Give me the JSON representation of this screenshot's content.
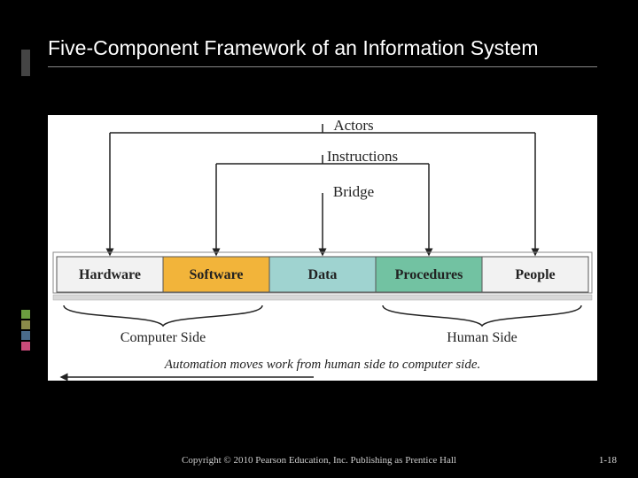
{
  "title": "Five-Component Framework of an Information System",
  "labels": {
    "actors": "Actors",
    "instructions": "Instructions",
    "bridge": "Bridge"
  },
  "components": [
    {
      "name": "Hardware",
      "color": "#f2f2f2"
    },
    {
      "name": "Software",
      "color": "#f2b43a"
    },
    {
      "name": "Data",
      "color": "#9fd3d0"
    },
    {
      "name": "Procedures",
      "color": "#72c2a2"
    },
    {
      "name": "People",
      "color": "#f2f2f2"
    }
  ],
  "sides": {
    "computer": "Computer Side",
    "human": "Human Side"
  },
  "caption": "Automation moves work from human side to computer side.",
  "copyright": "Copyright © 2010 Pearson Education, Inc. Publishing as Prentice Hall",
  "slidenum": "1-18",
  "chart_data": {
    "type": "diagram",
    "title": "Five-Component Framework of an Information System",
    "components": [
      "Hardware",
      "Software",
      "Data",
      "Procedures",
      "People"
    ],
    "pair_groups": [
      {
        "label": "Actors",
        "members": [
          "Hardware",
          "People"
        ]
      },
      {
        "label": "Instructions",
        "members": [
          "Software",
          "Procedures"
        ]
      },
      {
        "label": "Bridge",
        "members": [
          "Data"
        ]
      }
    ],
    "side_groups": [
      {
        "label": "Computer Side",
        "members": [
          "Hardware",
          "Software"
        ]
      },
      {
        "label": "Human Side",
        "members": [
          "Procedures",
          "People"
        ]
      }
    ],
    "annotation": "Automation moves work from human side to computer side."
  }
}
